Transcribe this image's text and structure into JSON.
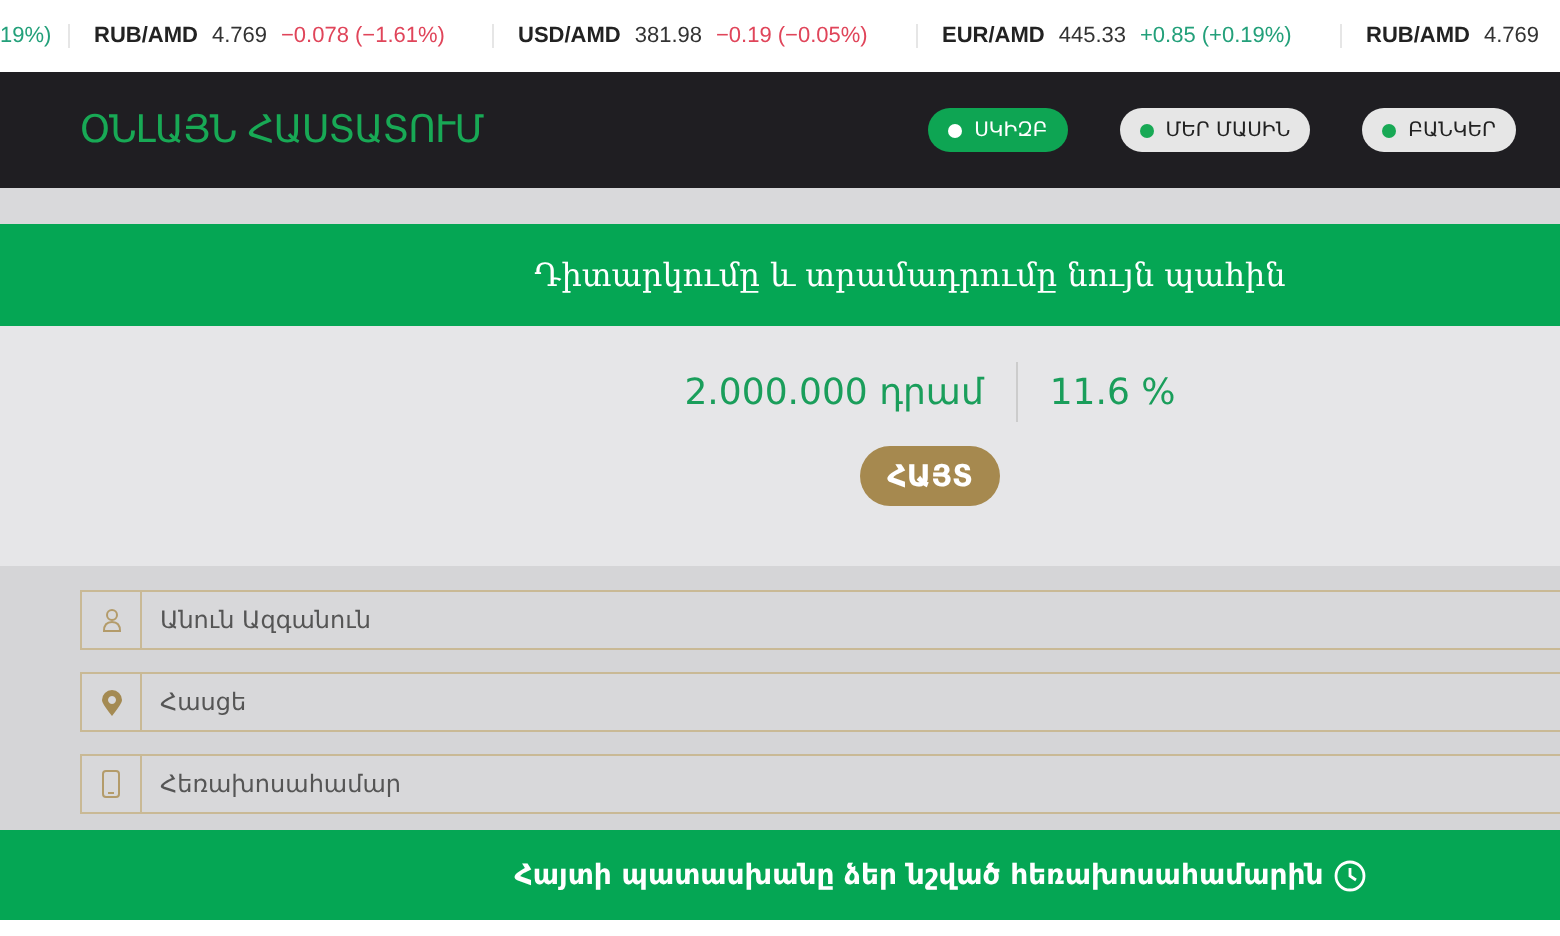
{
  "ticker": [
    {
      "change": "19%)",
      "color": "#23a07a"
    },
    {
      "pair": "RUB/AMD",
      "price": "4.769",
      "change": "−0.078 (−1.61%)",
      "color": "#e0455a"
    },
    {
      "pair": "USD/AMD",
      "price": "381.98",
      "change": "−0.19 (−0.05%)",
      "color": "#e0455a"
    },
    {
      "pair": "EUR/AMD",
      "price": "445.33",
      "change": "+0.85 (+0.19%)",
      "color": "#23a07a"
    },
    {
      "pair": "RUB/AMD",
      "price": "4.769"
    }
  ],
  "header": {
    "logo": "ՕՆԼԱՅՆ ՀԱՍՏԱՏՈՒՄ",
    "nav": [
      {
        "label": "ՍԿԻԶԲ",
        "selected": true
      },
      {
        "label": "ՄԵՐ ՄԱՍԻՆ",
        "selected": false
      },
      {
        "label": "ԲԱՆԿԵՐ",
        "selected": false
      }
    ]
  },
  "banner": "Դիտարկումը և տրամադրումը նույն պահին",
  "offer": {
    "amount": "2.000.000 դրամ",
    "rate": "11.6 %",
    "button": "ՀԱՅՏ"
  },
  "form": [
    {
      "kind": "person",
      "placeholder": "Անուն Ազգանուն"
    },
    {
      "kind": "location",
      "placeholder": "Հասցե"
    },
    {
      "kind": "phone",
      "placeholder": "Հեռախոսահամար"
    }
  ],
  "footer_note": "Հայտի պատասխանը ձեր նշված հեռախոսահամարին"
}
